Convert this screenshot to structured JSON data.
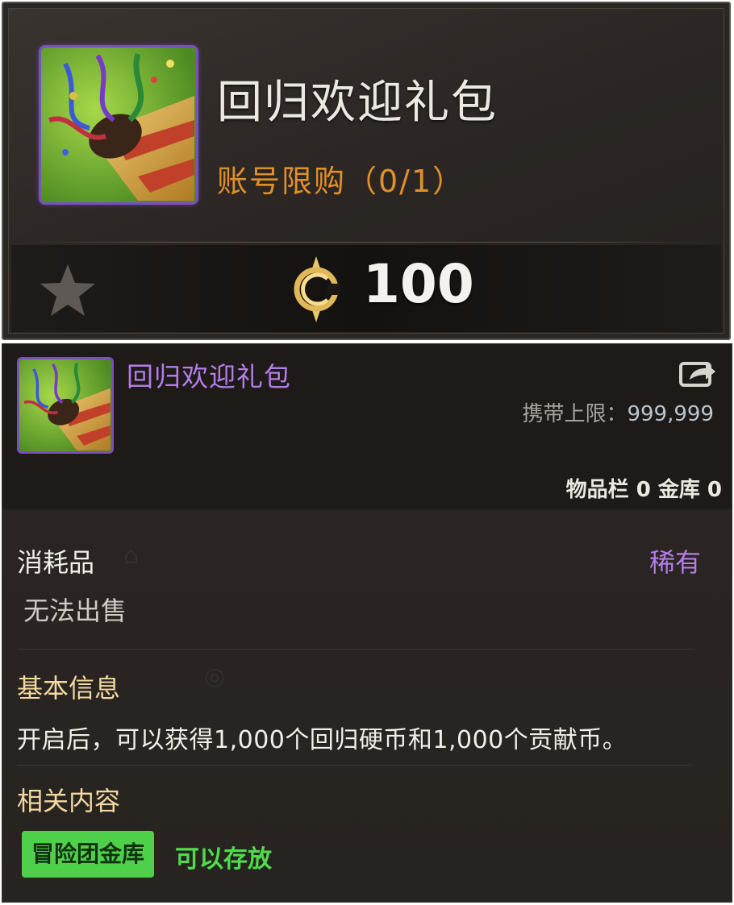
{
  "card": {
    "title": "回归欢迎礼包",
    "purchase_limit": "账号限购（0/1）",
    "price": "100",
    "icons": {
      "item": "party-popper-icon",
      "favorite": "star-icon",
      "currency": "coin-icon"
    }
  },
  "tooltip": {
    "name": "回归欢迎礼包",
    "carry_label": "携带上限：",
    "carry_value": "999,999",
    "stock": "物品栏 0 金库 0",
    "type": "消耗品",
    "rarity": "稀有",
    "sell_status": "无法出售",
    "basic_info_title": "基本信息",
    "description": "开启后，可以获得1,000个回归硬币和1,000个贡献币。",
    "related_title": "相关内容",
    "storage_tag": "冒险团金库",
    "storage_status": "可以存放",
    "icons": {
      "item": "party-popper-icon",
      "share": "share-icon"
    }
  },
  "colors": {
    "rare_purple": "#b57dea",
    "limit_orange": "#e0902a",
    "tag_green": "#4fd04a"
  }
}
